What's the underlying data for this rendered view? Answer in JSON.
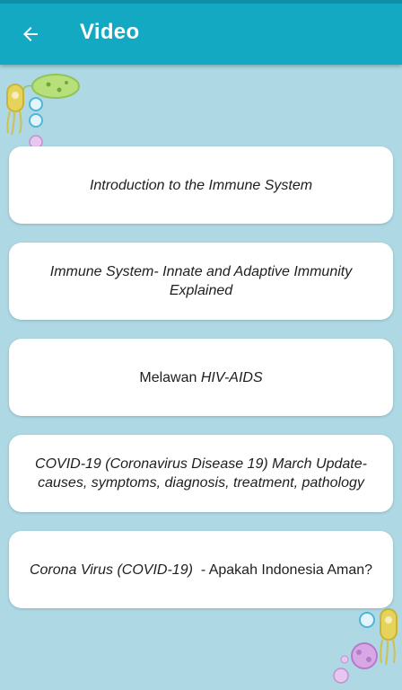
{
  "app_bar": {
    "title": "Video",
    "back_icon": "arrow-left-icon"
  },
  "colors": {
    "app_bar": "#14a9c3",
    "background": "#aed9e4",
    "card": "#ffffff"
  },
  "videos": [
    {
      "parts": [
        {
          "text": "Introduction to the Immune System",
          "italic": true
        }
      ]
    },
    {
      "parts": [
        {
          "text": "Immune System- Innate and Adaptive Immunity Explained",
          "italic": true
        }
      ]
    },
    {
      "parts": [
        {
          "text": "Melawan ",
          "italic": false
        },
        {
          "text": "HIV-AIDS",
          "italic": true
        }
      ]
    },
    {
      "parts": [
        {
          "text": "COVID-19 (Coronavirus Disease 19) March Update- causes, symptoms, diagnosis, treatment, pathology",
          "italic": true
        }
      ]
    },
    {
      "parts": [
        {
          "text": "Corona Virus (COVID-19)",
          "italic": true
        },
        {
          "text": "  - Apakah Indonesia Aman?",
          "italic": false
        }
      ]
    }
  ]
}
